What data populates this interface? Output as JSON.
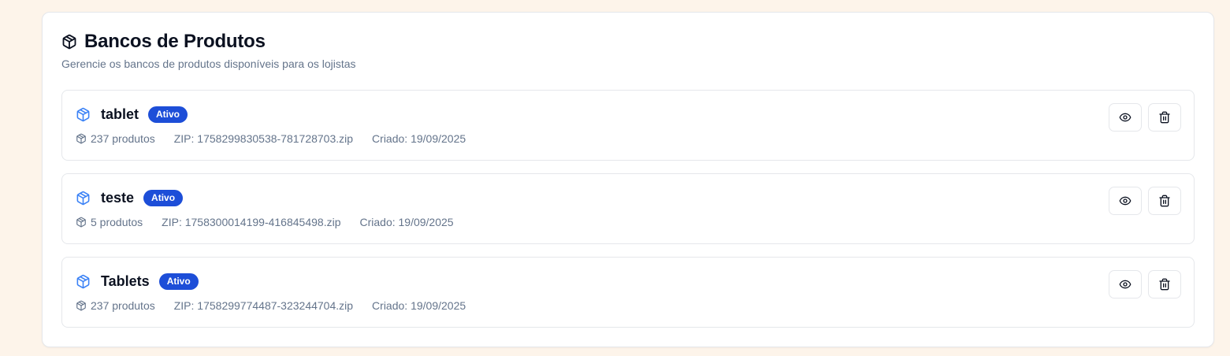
{
  "header": {
    "title": "Bancos de Produtos",
    "subtitle": "Gerencie os bancos de produtos disponíveis para os lojistas",
    "icon": "package-icon"
  },
  "items": [
    {
      "name": "tablet",
      "status": "Ativo",
      "count": "237 produtos",
      "zip": "ZIP: 1758299830538-781728703.zip",
      "created": "Criado: 19/09/2025"
    },
    {
      "name": "teste",
      "status": "Ativo",
      "count": "5 produtos",
      "zip": "ZIP: 1758300014199-416845498.zip",
      "created": "Criado: 19/09/2025"
    },
    {
      "name": "Tablets",
      "status": "Ativo",
      "count": "237 produtos",
      "zip": "ZIP: 1758299774487-323244704.zip",
      "created": "Criado: 19/09/2025"
    }
  ],
  "actions": {
    "view_icon": "eye-icon",
    "delete_icon": "trash-icon"
  },
  "colors": {
    "background": "#fdf4ea",
    "accent": "#1d4ed8",
    "item_icon": "#3b82f6",
    "muted_text": "#64748b"
  }
}
